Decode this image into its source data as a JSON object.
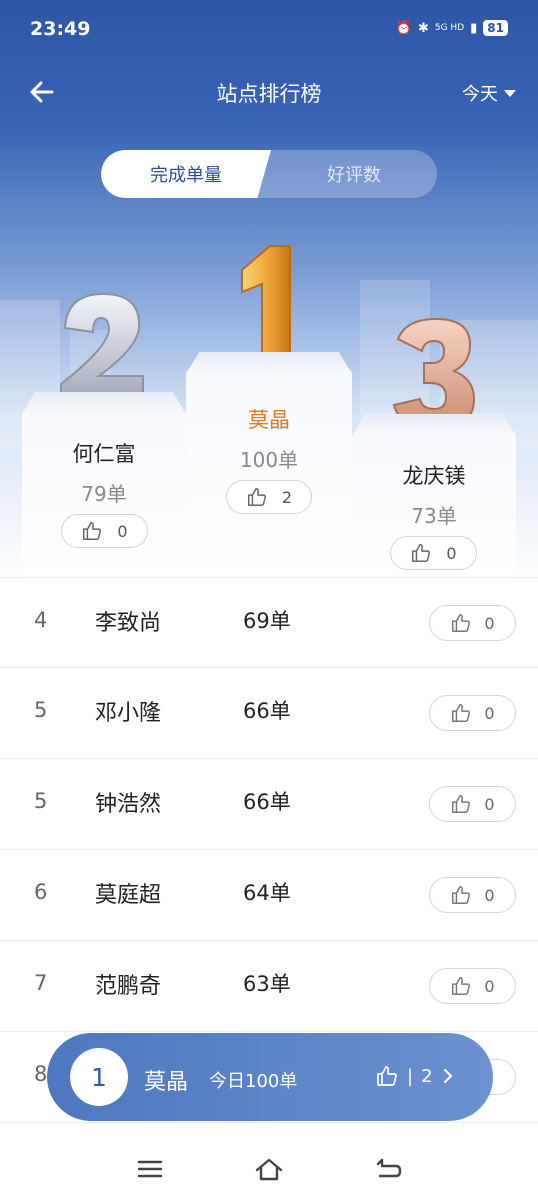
{
  "status": {
    "time": "23:49",
    "battery": "81",
    "network": "5G HD"
  },
  "header": {
    "title": "站点排行榜",
    "period": "今天"
  },
  "tabs": [
    {
      "label": "完成单量",
      "active": true
    },
    {
      "label": "好评数",
      "active": false
    }
  ],
  "podium": {
    "first": {
      "rank": "1",
      "name": "莫晶",
      "count": "100单",
      "likes": "2"
    },
    "second": {
      "rank": "2",
      "name": "何仁富",
      "count": "79单",
      "likes": "0"
    },
    "third": {
      "rank": "3",
      "name": "龙庆镁",
      "count": "73单",
      "likes": "0"
    }
  },
  "list": [
    {
      "rank": "4",
      "name": "李致尚",
      "count": "69单",
      "likes": "0"
    },
    {
      "rank": "5",
      "name": "邓小隆",
      "count": "66单",
      "likes": "0"
    },
    {
      "rank": "5",
      "name": "钟浩然",
      "count": "66单",
      "likes": "0"
    },
    {
      "rank": "6",
      "name": "莫庭超",
      "count": "64单",
      "likes": "0"
    },
    {
      "rank": "7",
      "name": "范鹏奇",
      "count": "63单",
      "likes": "0"
    },
    {
      "rank": "8",
      "name": "",
      "count": "",
      "likes": ""
    }
  ],
  "me": {
    "rank": "1",
    "name": "莫晶",
    "today": "今日100单",
    "likes": "2",
    "separator": "|"
  },
  "colors": {
    "primary": "#2c55a6",
    "gold": "#e07a22",
    "silver": "#c9ccd6",
    "bronze": "#d99b82"
  }
}
